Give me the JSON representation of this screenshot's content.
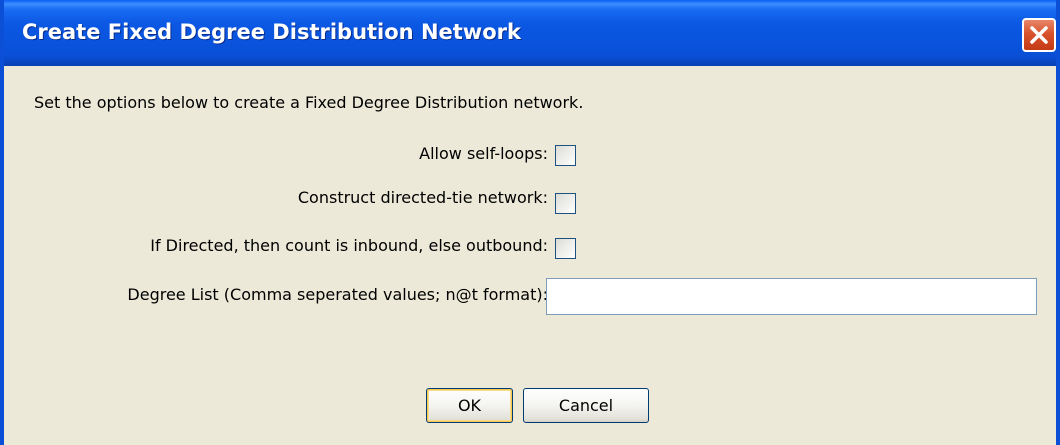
{
  "window": {
    "title": "Create Fixed Degree Distribution Network",
    "close_icon": "close-icon"
  },
  "form": {
    "intro": "Set the options below to create a Fixed Degree Distribution network.",
    "self_loops_label": "Allow self-loops:",
    "self_loops_checked": false,
    "directed_label": "Construct directed-tie network:",
    "directed_checked": false,
    "inbound_label": "If Directed, then count is inbound, else outbound:",
    "inbound_checked": false,
    "degree_list_label": "Degree List (Comma seperated values; n@t format):",
    "degree_list_value": ""
  },
  "buttons": {
    "ok_label": "OK",
    "cancel_label": "Cancel"
  },
  "colors": {
    "titlebar": "#0a54de",
    "dialog_background": "#ece9d8",
    "close_button": "#d8542d"
  }
}
